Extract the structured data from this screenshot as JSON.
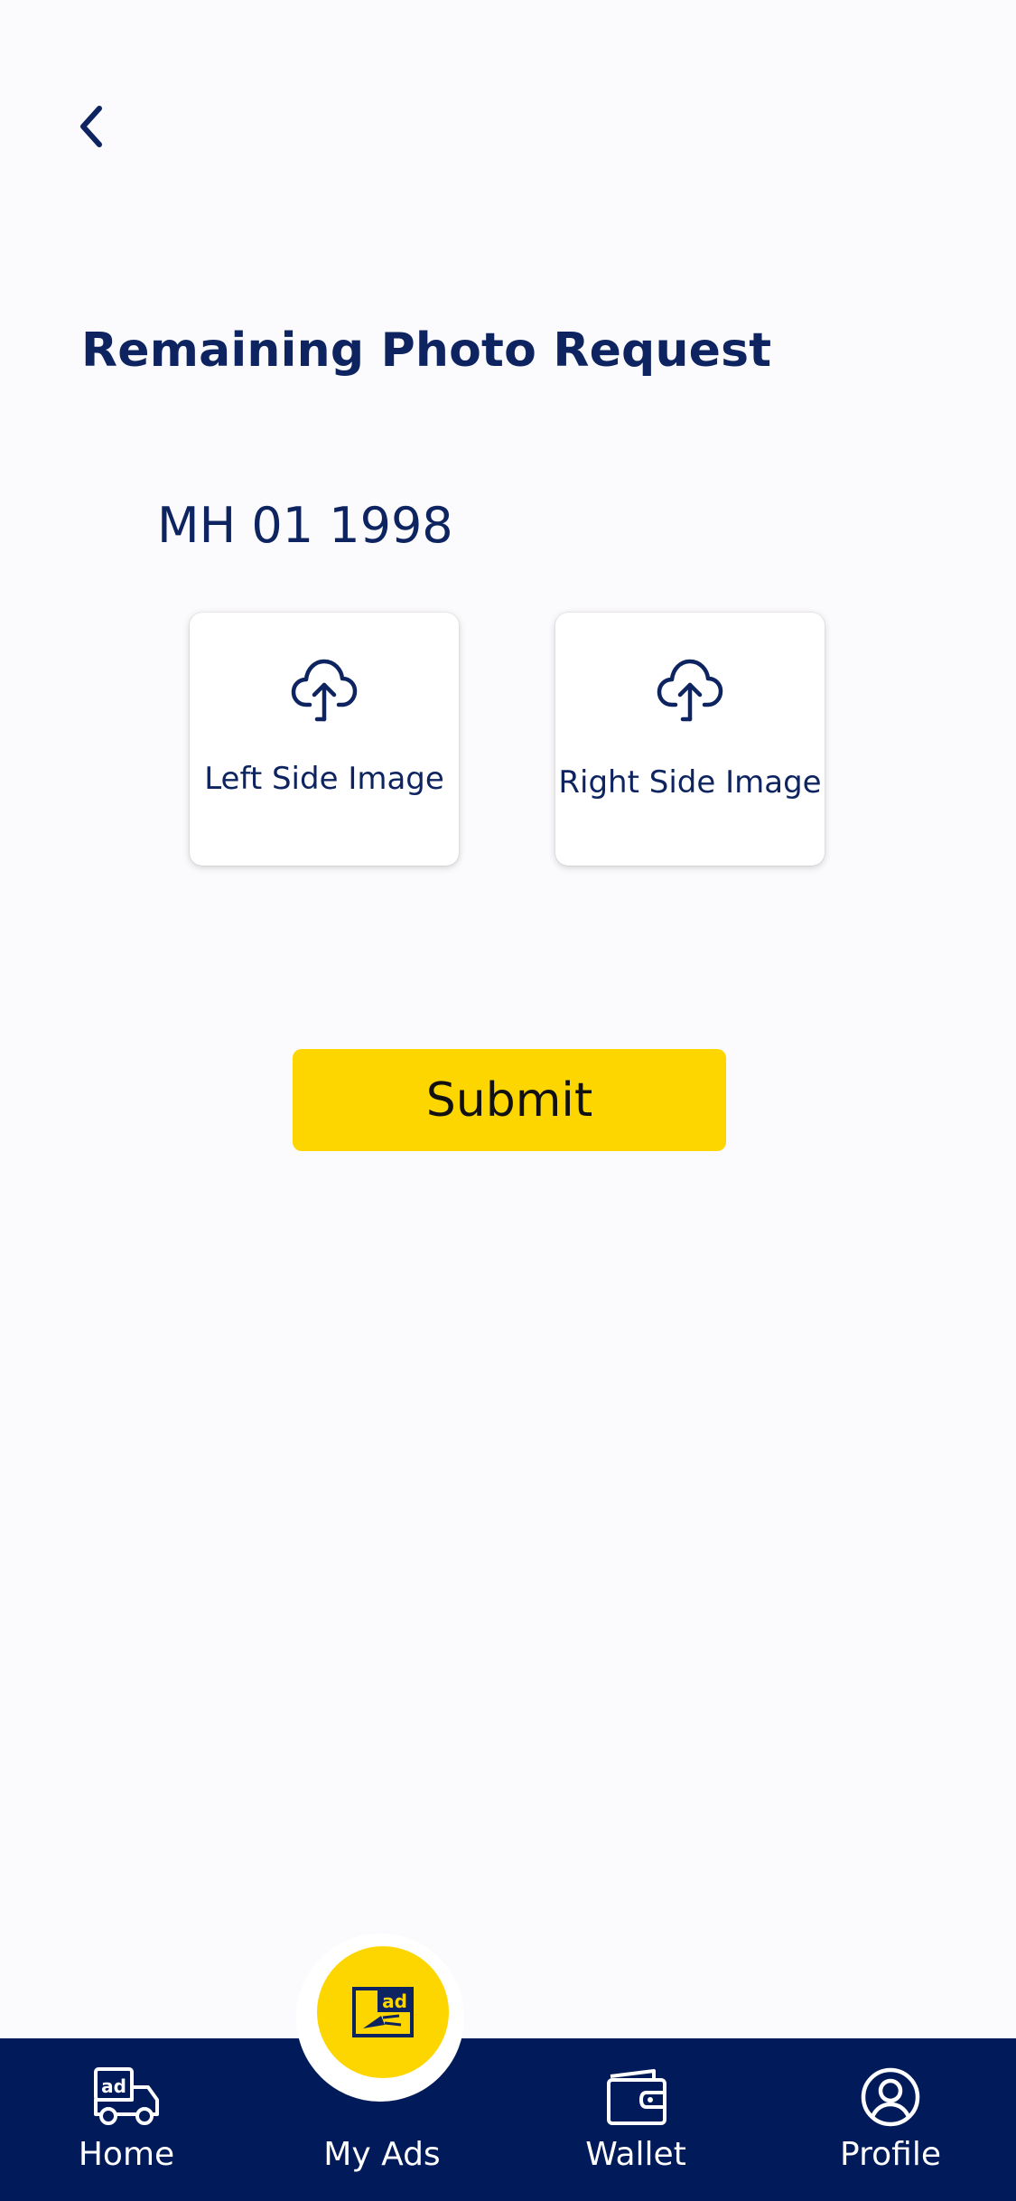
{
  "header": {
    "back_icon": "chevron-left-icon"
  },
  "page": {
    "title": "Remaining Photo Request",
    "vehicle_number": "MH 01 1998"
  },
  "uploads": [
    {
      "label": "Left Side Image",
      "icon": "cloud-upload-icon"
    },
    {
      "label": "Right Side Image",
      "icon": "cloud-upload-icon"
    }
  ],
  "actions": {
    "submit_label": "Submit"
  },
  "bottom_nav": {
    "items": [
      {
        "label": "Home",
        "icon": "ad-truck-icon"
      },
      {
        "label": "My Ads",
        "icon": "ad-megaphone-icon"
      },
      {
        "label": "Wallet",
        "icon": "wallet-icon"
      },
      {
        "label": "Profile",
        "icon": "user-circle-icon"
      }
    ]
  },
  "colors": {
    "primary": "#0e2460",
    "nav_background": "#001a5a",
    "accent": "#fdd600",
    "page_background": "#fbfafc"
  }
}
